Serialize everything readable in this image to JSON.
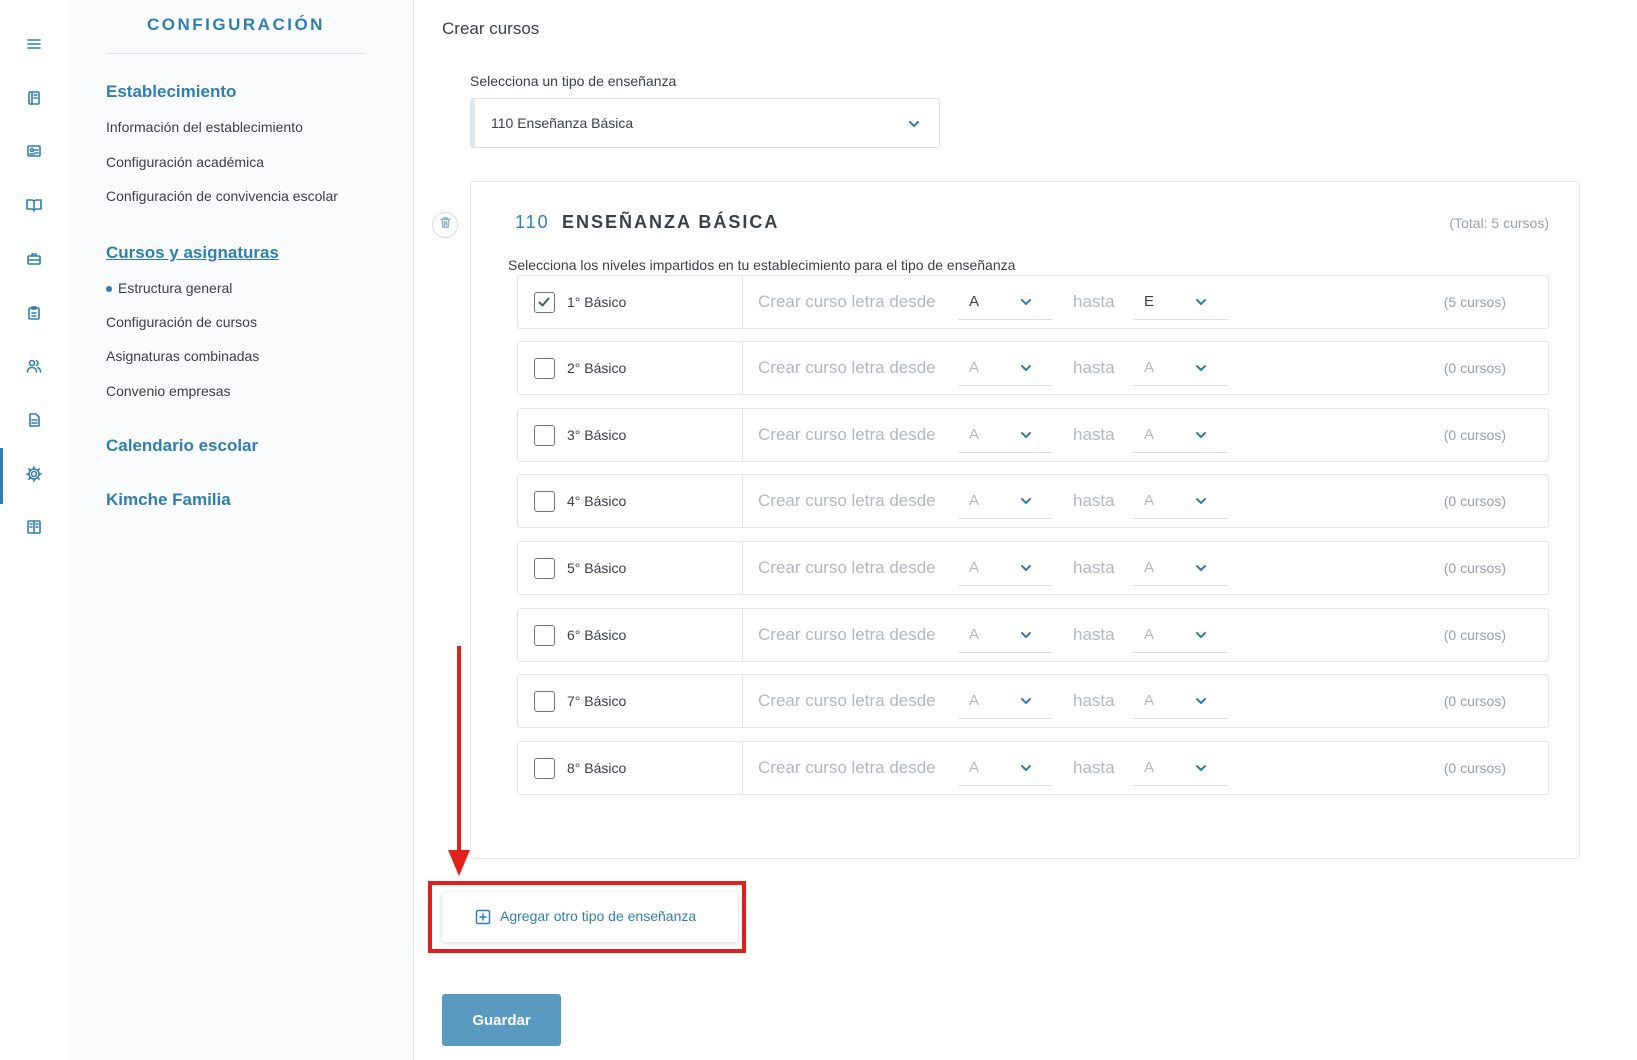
{
  "rail": {
    "items": [
      {
        "icon": "menu-icon"
      },
      {
        "icon": "notebook-icon"
      },
      {
        "icon": "id-card-icon"
      },
      {
        "icon": "book-open-icon"
      },
      {
        "icon": "briefcase-icon"
      },
      {
        "icon": "clipboard-icon"
      },
      {
        "icon": "users-icon"
      },
      {
        "icon": "document-icon"
      },
      {
        "icon": "gear-icon",
        "active": true
      },
      {
        "icon": "manual-icon"
      }
    ]
  },
  "sidebar": {
    "title": "CONFIGURACIÓN",
    "sections": [
      {
        "heading": "Establecimiento",
        "items": [
          "Información del establecimiento",
          "Configuración académica",
          "Configuración de convivencia escolar"
        ]
      },
      {
        "heading": "Cursos y asignaturas",
        "items": [
          "Estructura general",
          "Configuración de cursos",
          "Asignaturas combinadas",
          "Convenio empresas"
        ],
        "current_item": "Estructura general"
      },
      {
        "heading": "Calendario escolar",
        "items": []
      },
      {
        "heading": "Kimche Familia",
        "items": []
      }
    ]
  },
  "main": {
    "title": "Crear cursos",
    "select_label": "Selecciona un tipo de enseñanza",
    "selected_type": "110 Enseñanza Básica",
    "card": {
      "code": "110",
      "name": "ENSEÑANZA BÁSICA",
      "total": "(Total: 5 cursos)",
      "instruction": "Selecciona los niveles impartidos en tu establecimiento para el tipo de enseñanza",
      "from_label": "Crear curso letra desde",
      "to_label": "hasta",
      "levels": [
        {
          "name": "1° Básico",
          "checked": true,
          "from": "A",
          "to": "E",
          "count": "(5 cursos)"
        },
        {
          "name": "2° Básico",
          "checked": false,
          "from": "A",
          "to": "A",
          "count": "(0 cursos)"
        },
        {
          "name": "3° Básico",
          "checked": false,
          "from": "A",
          "to": "A",
          "count": "(0 cursos)"
        },
        {
          "name": "4° Básico",
          "checked": false,
          "from": "A",
          "to": "A",
          "count": "(0 cursos)"
        },
        {
          "name": "5° Básico",
          "checked": false,
          "from": "A",
          "to": "A",
          "count": "(0 cursos)"
        },
        {
          "name": "6° Básico",
          "checked": false,
          "from": "A",
          "to": "A",
          "count": "(0 cursos)"
        },
        {
          "name": "7° Básico",
          "checked": false,
          "from": "A",
          "to": "A",
          "count": "(0 cursos)"
        },
        {
          "name": "8° Básico",
          "checked": false,
          "from": "A",
          "to": "A",
          "count": "(0 cursos)"
        }
      ]
    },
    "add_type_label": "Agregar otro tipo de enseñanza",
    "save_label": "Guardar"
  },
  "colors": {
    "accent": "#2f7fb0",
    "save_button": "#5a9ac0",
    "annotation": "#e0201c"
  }
}
